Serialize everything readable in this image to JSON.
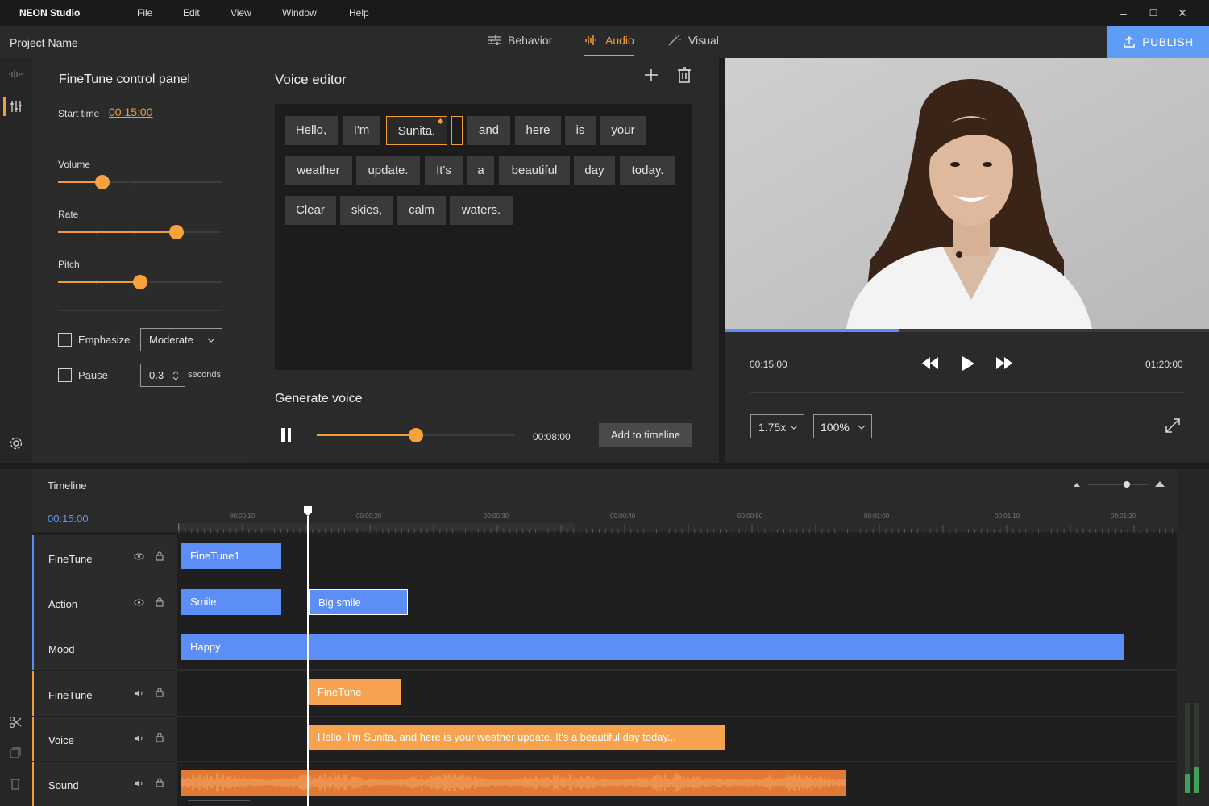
{
  "app": {
    "name": "NEON Studio"
  },
  "menu": [
    "File",
    "Edit",
    "View",
    "Window",
    "Help"
  ],
  "window_controls": {
    "minimize": "–",
    "maximize": "☐",
    "close": "✕"
  },
  "project": {
    "name": "Project Name"
  },
  "tabs": [
    {
      "label": "Behavior",
      "icon": "sliders-icon",
      "active": false
    },
    {
      "label": "Audio",
      "icon": "audio-wave-icon",
      "active": true
    },
    {
      "label": "Visual",
      "icon": "magic-wand-icon",
      "active": false
    }
  ],
  "publish": {
    "label": "PUBLISH",
    "icon": "upload-icon"
  },
  "finetune": {
    "title": "FineTune control panel",
    "start_time_label": "Start time",
    "start_time": "00:15:00",
    "volume_label": "Volume",
    "volume_value": 0.27,
    "rate_label": "Rate",
    "rate_value": 0.72,
    "pitch_label": "Pitch",
    "pitch_value": 0.5,
    "emphasize_label": "Emphasize",
    "emphasize_checked": false,
    "emphasize_option": "Moderate",
    "pause_label": "Pause",
    "pause_checked": false,
    "pause_value": "0.3",
    "pause_unit": "seconds"
  },
  "voice_editor": {
    "title": "Voice editor",
    "words_row1": [
      "Hello,",
      "I'm",
      "Sunita,",
      "",
      "and",
      "here",
      "is",
      "your"
    ],
    "words_row2": [
      "weather",
      "update.",
      "It's",
      "a",
      "beautiful",
      "day",
      "today."
    ],
    "words_row3": [
      "Clear",
      "skies,",
      "calm",
      "waters."
    ],
    "selected_word": "Sunita,",
    "generate_title": "Generate voice",
    "progress": 0.5,
    "time": "00:08:00",
    "add_button": "Add to timeline"
  },
  "player": {
    "current": "00:15:00",
    "total": "01:20:00",
    "progress": 0.36,
    "speed": "1.75x",
    "zoom": "100%"
  },
  "timeline": {
    "title": "Timeline",
    "current": "00:15:00",
    "ruler": [
      "00:00:10",
      "00:00:20",
      "00:00:30",
      "00:00:40",
      "00:00:50",
      "00:01:00",
      "00:01:10",
      "00:01:20"
    ],
    "tracks": [
      {
        "name": "FineTune",
        "type": "behavior"
      },
      {
        "name": "Action",
        "type": "behavior"
      },
      {
        "name": "Mood",
        "type": "behavior"
      },
      {
        "name": "FineTune",
        "type": "audio"
      },
      {
        "name": "Voice",
        "type": "audio"
      },
      {
        "name": "Sound",
        "type": "audio"
      }
    ],
    "clips": {
      "finetune1": "FineTune1",
      "smile": "Smile",
      "big_smile": "Big smile",
      "happy": "Happy",
      "finetune_audio": "FineTune",
      "voice": "Hello, I'm Sunita, and here is your weather update.  It's a beautiful day today..."
    }
  },
  "colors": {
    "accent": "#f39c3c",
    "blue": "#5d8ef5",
    "publish": "#5d9cf7"
  }
}
